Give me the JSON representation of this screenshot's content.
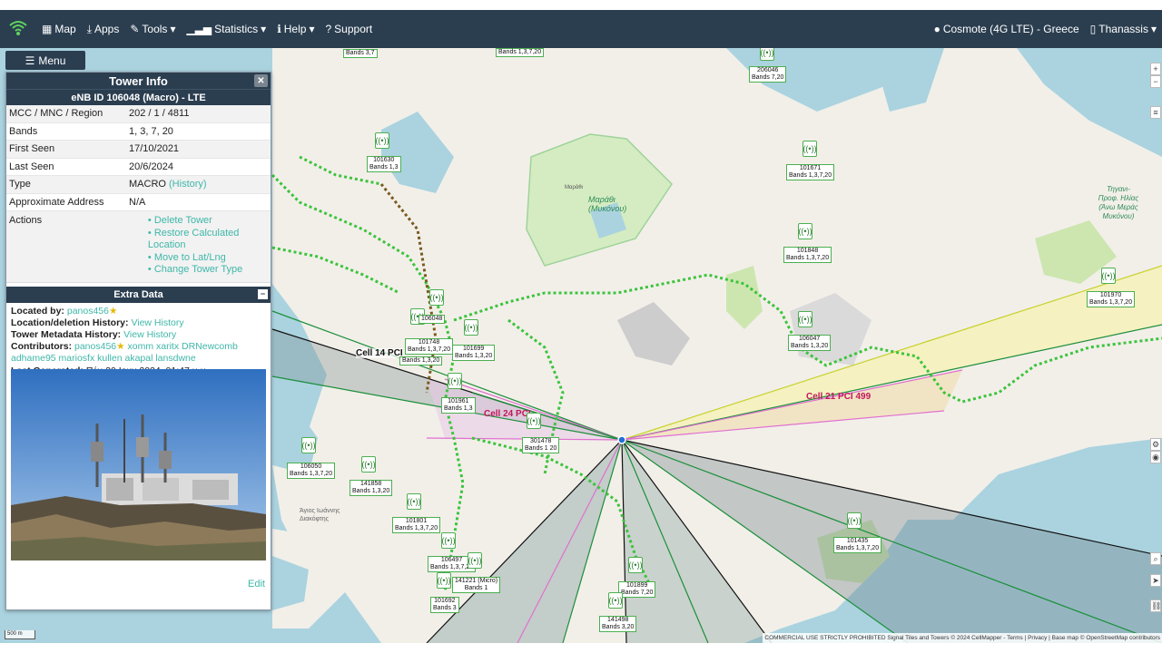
{
  "nav": {
    "map": "Map",
    "apps": "Apps",
    "tools": "Tools",
    "statistics": "Statistics",
    "help": "Help",
    "support": "Support",
    "network": "Cosmote (4G LTE) - Greece",
    "user": "Thanassis"
  },
  "menu_label": "Menu",
  "panel": {
    "title": "Tower Info",
    "subtitle": "eNB ID 106048 (Macro) - LTE",
    "rows": [
      {
        "key": "MCC / MNC / Region",
        "value": "202 / 1 / 4811"
      },
      {
        "key": "Bands",
        "value": "1, 3, 7, 20"
      },
      {
        "key": "First Seen",
        "value": "17/10/2021"
      },
      {
        "key": "Last Seen",
        "value": "20/6/2024"
      },
      {
        "key": "Type",
        "value": "MACRO",
        "link": "(History)"
      },
      {
        "key": "Approximate Address",
        "value": "N/A"
      }
    ],
    "actions_label": "Actions",
    "actions": [
      "Delete Tower",
      "Restore Calculated Location",
      "Move to Lat/Lng",
      "Change Tower Type"
    ],
    "extra_title": "Extra Data",
    "located_by_label": "Located by:",
    "located_by": "panos456",
    "location_history_label": "Location/deletion History:",
    "metadata_history_label": "Tower Metadata History:",
    "view_history": "View History",
    "contributors_label": "Contributors:",
    "contributors_first": "panos456",
    "contributors_rest": "xomm xaritx DRNewcomb adhame95 mariosfx kullen akapal lansdwne",
    "last_generated_label": "Last Generated:",
    "last_generated": "Πέμ 20 Ιουν 2024, 01:47 μ.μ.",
    "edit": "Edit"
  },
  "towers": [
    {
      "id": "",
      "bands": "Bands 3,7"
    },
    {
      "id": "",
      "bands": "Bands 1,3,7,20"
    },
    {
      "id": "206046",
      "bands": "Bands 7,20"
    },
    {
      "id": "101630",
      "bands": "Bands 1,3"
    },
    {
      "id": "101671",
      "bands": "Bands 1,3,7,20"
    },
    {
      "id": "101848",
      "bands": "Bands 1,3,7,20"
    },
    {
      "id": "101970",
      "bands": "Bands 1,3,7,20"
    },
    {
      "id": "106048",
      "bands": ""
    },
    {
      "id": "101748",
      "bands": "Bands 1,3,7,20"
    },
    {
      "id": "101699",
      "bands": "Bands 1,3,20"
    },
    {
      "id": "",
      "bands": "Bands 1,3,20"
    },
    {
      "id": "106047",
      "bands": "Bands 1,3,20"
    },
    {
      "id": "101961",
      "bands": "Bands 1,3"
    },
    {
      "id": "301478",
      "bands": "Bands 1 20"
    },
    {
      "id": "106050",
      "bands": "Bands 1,3,7,20"
    },
    {
      "id": "141858",
      "bands": "Bands 1,3,20"
    },
    {
      "id": "101801",
      "bands": "Bands 1,3,7,20"
    },
    {
      "id": "106497",
      "bands": "Bands 1,3,7,20"
    },
    {
      "id": "141221 (Micro)",
      "bands": "Bands 1"
    },
    {
      "id": "101692",
      "bands": "Bands 3"
    },
    {
      "id": "101899",
      "bands": "Bands 7,20"
    },
    {
      "id": "141498",
      "bands": "Bands 3,20"
    },
    {
      "id": "101435",
      "bands": "Bands 1,3,7,20"
    }
  ],
  "cells": [
    {
      "label": "Cell 14 PCI",
      "color": "#2e7d32"
    },
    {
      "label": "Cell 24 PCI",
      "color": "#c2185b"
    },
    {
      "label": "Cell 21 PCI 499",
      "color": "#c2185b"
    }
  ],
  "map_labels": {
    "marathi": "Μαράθι\n(Μυκόνου)",
    "marathi_small": "Μαράθι",
    "ano_mera": "Τηγανι-\nΠροφ. Ηλίας\n(Άνω Μεράς\nΜυκόνου)",
    "agios_ioannis": "Άγιος Ιωάννης\nΔιακόφτης"
  },
  "scale": "500 m",
  "attribution": "COMMERCIAL USE STRICTLY PROHIBITED Signal Tiles and Towers © 2024 CellMapper - Terms | Privacy | Base map © OpenStreetMap contributors",
  "colors": {
    "navbar": "#2b3e50",
    "link": "#3fb7a9",
    "tower": "#4caf50",
    "sea": "#aad3df",
    "land": "#f2efe9"
  }
}
